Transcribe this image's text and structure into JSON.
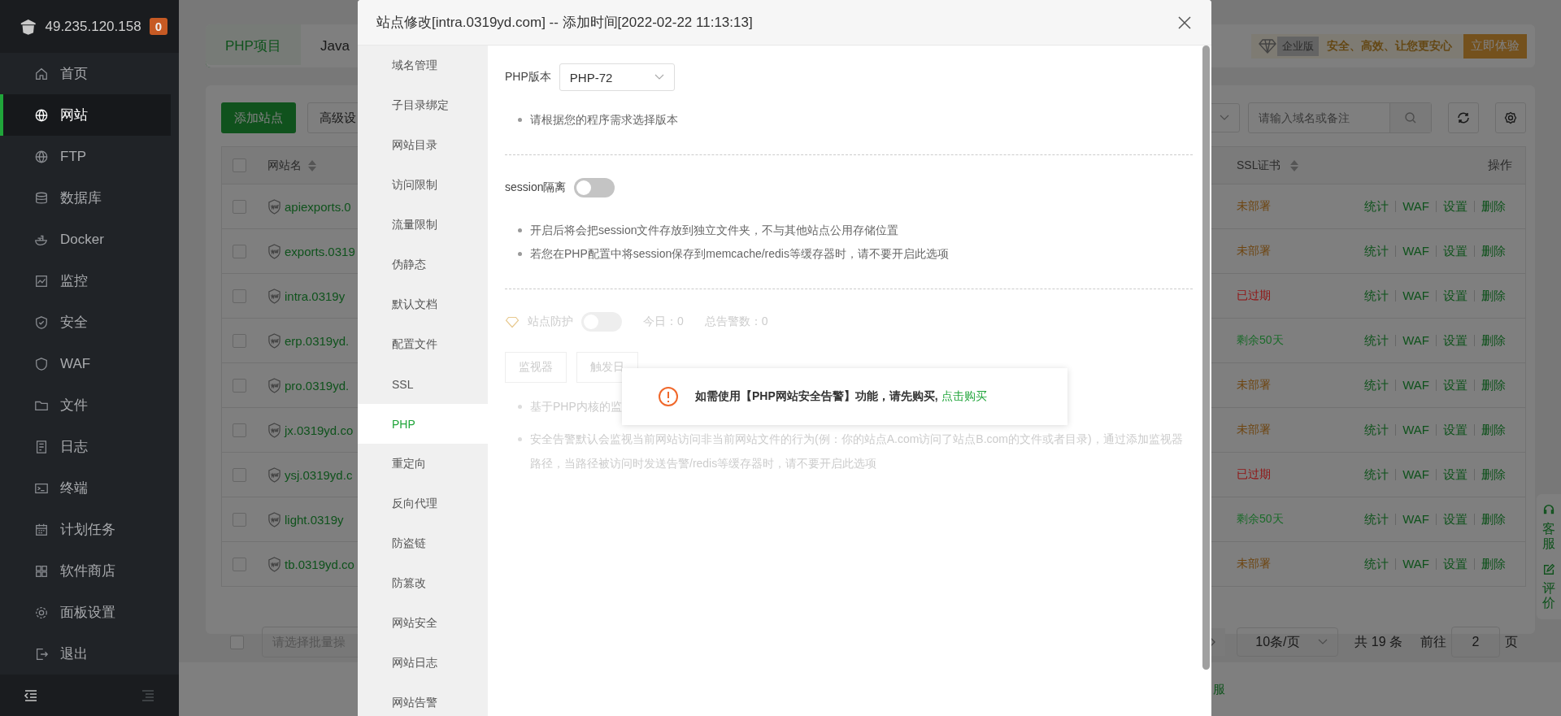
{
  "server": {
    "ip": "49.235.120.158",
    "badge": "0"
  },
  "sidebar": {
    "items": [
      {
        "label": "首页",
        "selected": false
      },
      {
        "label": "网站",
        "selected": true
      },
      {
        "label": "FTP",
        "selected": false
      },
      {
        "label": "数据库",
        "selected": false
      },
      {
        "label": "Docker",
        "selected": false
      },
      {
        "label": "监控",
        "selected": false
      },
      {
        "label": "安全",
        "selected": false
      },
      {
        "label": "WAF",
        "selected": false
      },
      {
        "label": "文件",
        "selected": false
      },
      {
        "label": "日志",
        "selected": false
      },
      {
        "label": "终端",
        "selected": false
      },
      {
        "label": "计划任务",
        "selected": false
      },
      {
        "label": "软件商店",
        "selected": false
      },
      {
        "label": "面板设置",
        "selected": false
      },
      {
        "label": "退出",
        "selected": false
      }
    ]
  },
  "tabs": [
    {
      "label": "PHP项目",
      "selected": true
    },
    {
      "label": "Java",
      "selected": false
    }
  ],
  "promo": {
    "edition": "企业版",
    "slogan": "安全、高效、让您更安心",
    "button": "立即体验"
  },
  "toolbar": {
    "add_button": "添加站点",
    "advanced_button": "高级设",
    "search": {
      "placeholder": "请输入域名或备注"
    }
  },
  "table": {
    "select_all_checked": false,
    "columns": [
      "网站名",
      "SSL证书",
      "操作"
    ],
    "rows": [
      {
        "name": "apiexports.0",
        "checked": false,
        "ssl": "未部署",
        "color": "#6e4510",
        "actions": [
          "统计",
          "WAF",
          "设置",
          "删除"
        ]
      },
      {
        "name": "exports.0319",
        "checked": false,
        "ssl": "未部署",
        "color": "#6e4510",
        "actions": [
          "统计",
          "WAF",
          "设置",
          "删除"
        ]
      },
      {
        "name": "intra.0319y",
        "checked": false,
        "ssl": "已过期",
        "color": "#920f0f",
        "actions": [
          "统计",
          "WAF",
          "设置",
          "删除"
        ]
      },
      {
        "name": "erp.0319yd.",
        "checked": false,
        "ssl": "剩余50天",
        "color": "#1c6b2b",
        "actions": [
          "统计",
          "WAF",
          "设置",
          "删除"
        ]
      },
      {
        "name": "pro.0319yd.",
        "checked": false,
        "ssl": "未部署",
        "color": "#6e4510",
        "actions": [
          "统计",
          "WAF",
          "设置",
          "删除"
        ]
      },
      {
        "name": "jx.0319yd.co",
        "checked": false,
        "ssl": "未部署",
        "color": "#6e4510",
        "actions": [
          "统计",
          "WAF",
          "设置",
          "删除"
        ]
      },
      {
        "name": "ysj.0319yd.c",
        "checked": false,
        "ssl": "已过期",
        "color": "#920f0f",
        "actions": [
          "统计",
          "WAF",
          "设置",
          "删除"
        ]
      },
      {
        "name": "light.0319y",
        "checked": false,
        "ssl": "剩余50天",
        "color": "#1c6b2b",
        "actions": [
          "统计",
          "WAF",
          "设置",
          "删除"
        ]
      },
      {
        "name": "tb.0319yd.co",
        "checked": false,
        "ssl": "未部署",
        "color": "#6e4510",
        "actions": [
          "统计",
          "WAF",
          "设置",
          "删除"
        ]
      }
    ]
  },
  "pagination": {
    "batch_checked": false,
    "batch_placeholder": "请选择批量操",
    "page_size": "10条/页",
    "total": "共 19 条",
    "goto_label": "前往",
    "page": "2",
    "page_unit": "页"
  },
  "footer": {
    "text": "服"
  },
  "float_widget": [
    {
      "label": "客服"
    },
    {
      "label": "评价"
    }
  ],
  "dialog": {
    "title": "站点修改[intra.0319yd.com] -- 添加时间[2022-02-22 11:13:13]",
    "nav": [
      {
        "label": "域名管理",
        "selected": false
      },
      {
        "label": "子目录绑定",
        "selected": false
      },
      {
        "label": "网站目录",
        "selected": false
      },
      {
        "label": "访问限制",
        "selected": false
      },
      {
        "label": "流量限制",
        "selected": false
      },
      {
        "label": "伪静态",
        "selected": false
      },
      {
        "label": "默认文档",
        "selected": false
      },
      {
        "label": "配置文件",
        "selected": false
      },
      {
        "label": "SSL",
        "selected": false
      },
      {
        "label": "PHP",
        "selected": true
      },
      {
        "label": "重定向",
        "selected": false
      },
      {
        "label": "反向代理",
        "selected": false
      },
      {
        "label": "防盗链",
        "selected": false
      },
      {
        "label": "防篡改",
        "selected": false
      },
      {
        "label": "网站安全",
        "selected": false
      },
      {
        "label": "网站日志",
        "selected": false
      },
      {
        "label": "网站告警",
        "selected": false
      }
    ],
    "php_version": {
      "label": "PHP版本",
      "value": "PHP-72"
    },
    "version_tips": [
      "请根据您的程序需求选择版本"
    ],
    "session": {
      "label": "session隔离",
      "on": false,
      "tips": [
        "开启后将会把session文件存放到独立文件夹，不与其他站点公用存储位置",
        "若您在PHP配置中将session保存到memcache/redis等缓存器时，请不要开启此选项"
      ]
    },
    "protection": {
      "label": "站点防护",
      "on": false,
      "disabled": true,
      "today": "今日：0",
      "total": "总告警数：0",
      "buttons": [
        "监视器",
        "触发日"
      ],
      "tips": [
        "基于PHP内核的监",
        "安全告警默认会监视当前网站访问非当前网站文件的行为(例：你的站点A.com访问了站点B.com的文件或者目录)，通过添加监视器路径，当路径被访问时发送告警/redis等缓存器时，请不要开启此选项"
      ]
    },
    "toast": {
      "message": "如需使用【PHP网站安全告警】功能，请先购买, ",
      "link": "点击购买"
    }
  }
}
